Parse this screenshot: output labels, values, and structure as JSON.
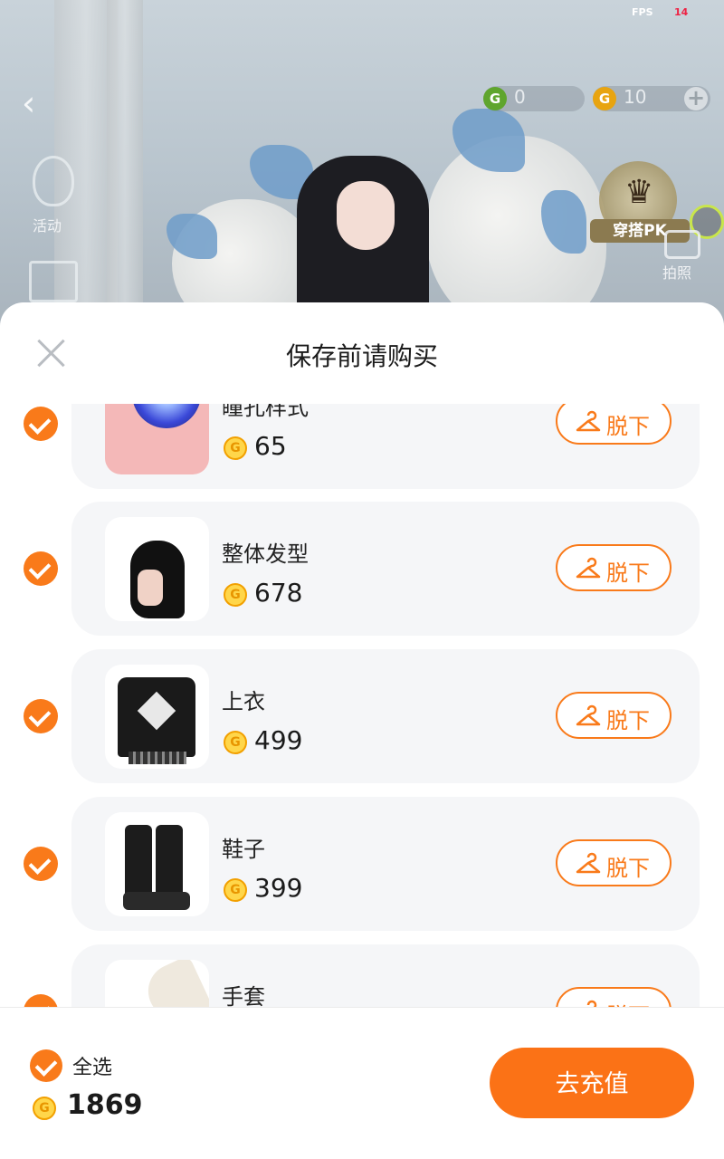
{
  "status_bar": {
    "fps_label": "FPS",
    "fps_value": "14"
  },
  "hud": {
    "green_currency": "0",
    "gold_currency": "10",
    "activity_label": "活动",
    "pk_label": "穿搭PK",
    "photo_label": "拍照"
  },
  "sheet": {
    "title": "保存前请购买",
    "items": [
      {
        "name": "瞳孔样式",
        "price": "65",
        "action": "脱下",
        "thumb": "eye"
      },
      {
        "name": "整体发型",
        "price": "678",
        "action": "脱下",
        "thumb": "hair"
      },
      {
        "name": "上衣",
        "price": "499",
        "action": "脱下",
        "thumb": "shirt"
      },
      {
        "name": "鞋子",
        "price": "399",
        "action": "脱下",
        "thumb": "shoes"
      },
      {
        "name": "手套",
        "price": "",
        "action": "脱下",
        "thumb": "glove"
      }
    ]
  },
  "footer": {
    "select_all_label": "全选",
    "total": "1869",
    "recharge_label": "去充值"
  },
  "colors": {
    "accent": "#f97a1a",
    "coin": "#ffd64a"
  }
}
